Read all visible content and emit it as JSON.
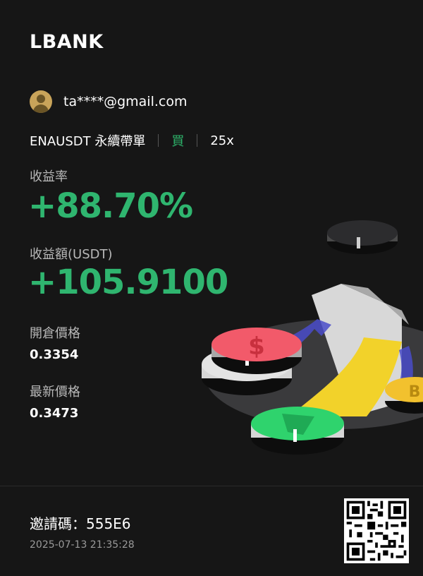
{
  "brand": {
    "logo_text": "LBANK"
  },
  "user": {
    "email": "ta****@gmail.com",
    "avatar_icon": "user-avatar-icon"
  },
  "trade": {
    "pair": "ENAUSDT 永續帶單",
    "side": "買",
    "leverage": "25x"
  },
  "metrics": {
    "roi_label": "收益率",
    "roi_value": "+88.70%",
    "pnl_label": "收益額(USDT)",
    "pnl_value": "+105.9100",
    "entry_label": "開倉價格",
    "entry_value": "0.3354",
    "last_label": "最新價格",
    "last_value": "0.3473"
  },
  "footer": {
    "invite": "邀請碼：555E6",
    "timestamp": "2025-07-13 21:35:28",
    "qr_icon": "qr-code-icon"
  },
  "colors": {
    "background": "#161616",
    "profit_green": "#2fb56f",
    "side_green": "#2db46b",
    "coin_red": "#f25a6a",
    "coin_green": "#2fd36d",
    "coin_gold": "#f2c12e",
    "arrow_yellow": "#f2d22a"
  }
}
